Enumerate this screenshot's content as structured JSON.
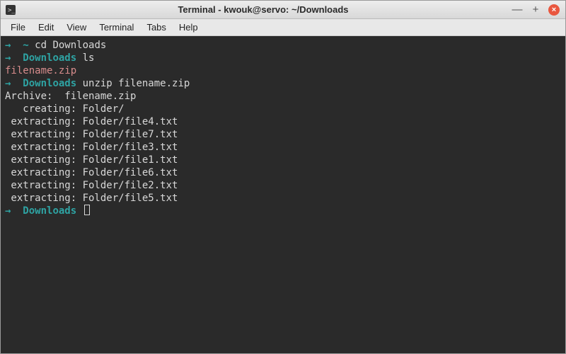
{
  "window": {
    "title": "Terminal - kwouk@servo: ~/Downloads"
  },
  "menubar": {
    "items": [
      "File",
      "Edit",
      "View",
      "Terminal",
      "Tabs",
      "Help"
    ]
  },
  "terminal": {
    "prompt_arrow": "→",
    "lines": [
      {
        "type": "prompt",
        "path": "~",
        "command": "cd Downloads"
      },
      {
        "type": "prompt",
        "path": "Downloads",
        "command": "ls"
      },
      {
        "type": "file",
        "text": "filename.zip"
      },
      {
        "type": "prompt",
        "path": "Downloads",
        "command": "unzip filename.zip"
      },
      {
        "type": "plain",
        "text": "Archive:  filename.zip"
      },
      {
        "type": "plain",
        "text": "   creating: Folder/"
      },
      {
        "type": "plain",
        "text": " extracting: Folder/file4.txt"
      },
      {
        "type": "plain",
        "text": " extracting: Folder/file7.txt"
      },
      {
        "type": "plain",
        "text": " extracting: Folder/file3.txt"
      },
      {
        "type": "plain",
        "text": " extracting: Folder/file1.txt"
      },
      {
        "type": "plain",
        "text": " extracting: Folder/file6.txt"
      },
      {
        "type": "plain",
        "text": " extracting: Folder/file2.txt"
      },
      {
        "type": "plain",
        "text": " extracting: Folder/file5.txt"
      },
      {
        "type": "prompt",
        "path": "Downloads",
        "command": "",
        "cursor": true
      }
    ]
  }
}
